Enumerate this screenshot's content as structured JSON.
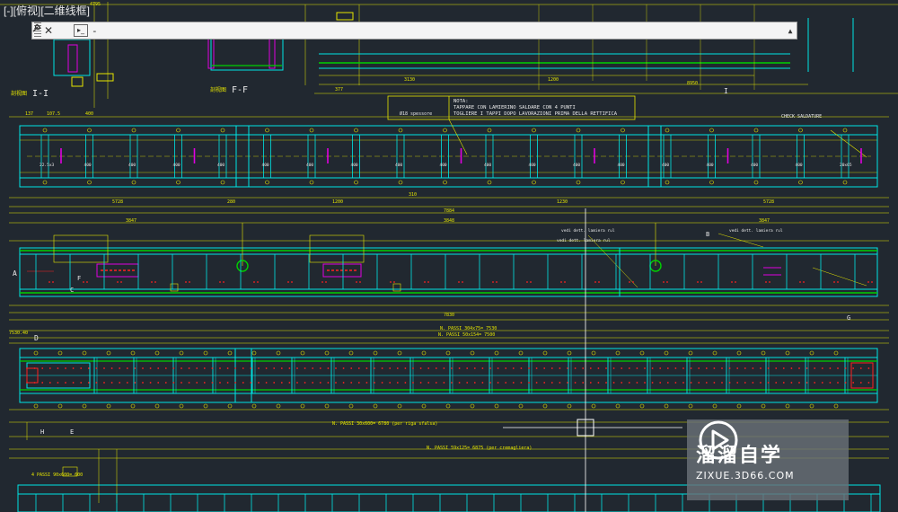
{
  "viewport": {
    "label": "[-][俯视][二维线框]",
    "colors": {
      "background": "#212830",
      "cyan": "#00e5e5",
      "yellow": "#e6e600",
      "green": "#00d000",
      "magenta": "#e000e0",
      "red": "#ff2020",
      "white": "#e8e8e8"
    }
  },
  "command_line": {
    "close_icon": "close-icon",
    "settings_icon": "wrench-icon",
    "prompt_icon": "command-prompt-icon",
    "prompt_glyph": "▸_",
    "input_value": "-",
    "dropdown_icon": "chevron-up-icon"
  },
  "drawing": {
    "section_labels": {
      "i_i": "I-I",
      "f_f": "F-F",
      "prefix": "剖视图"
    },
    "nota": {
      "title": "NOTA:",
      "line1": "TAPPARE CON LAMIERINO SALDARE CON 4 PUNTI",
      "line2": "TOGLIERE I TAPPI DOPO LAVORAZIONI PRIMA DELLA RETTIFICA",
      "side_label": "Ø18 spessore"
    },
    "check_label": "CHECK SALDATURE",
    "dims_top": {
      "d1": "137",
      "d2": "107.5",
      "d3": "400",
      "d4": "377",
      "d5": "3130",
      "d6": "1200",
      "d7": "8950",
      "d8": "4795"
    },
    "dims_band1": {
      "left": "5728",
      "mid1": "1200",
      "mid2": "1230",
      "right": "5728",
      "total": "7884",
      "h1": "280",
      "h2": "310"
    },
    "dims_band2": {
      "d1": "3847",
      "d2": "3848",
      "d3": "3847",
      "total": "7830"
    },
    "dims_band3": {
      "d1": "N. PASSI 304x75= 7530",
      "d2": "N. PASSI 50x154= 7500",
      "d3": "7530.40"
    },
    "bottom_notes": {
      "n1": "N. PASSI 30x600= 6780 (per riga sfalsa)",
      "n2": "N. PASSI 59x125= 6875 (per cremagliera)",
      "d1": "4 PASSI 90x600= 600"
    },
    "annotations": {
      "a1": "vedi dett. lamiera rul",
      "a2": "vedi dett. lamiera rul",
      "a3": "vedi dett. lamiera rul"
    },
    "markers": {
      "A": "A",
      "B": "B",
      "C": "C",
      "D": "D",
      "E": "E",
      "F": "F",
      "G": "G",
      "H": "H",
      "I": "I"
    },
    "hole_labels": [
      "22.5x3",
      "400",
      "400",
      "400",
      "400",
      "400",
      "400",
      "400",
      "400",
      "400",
      "400",
      "400",
      "400",
      "400",
      "400",
      "400",
      "400",
      "400",
      "20x65"
    ]
  },
  "watermark": {
    "title": "溜溜自学",
    "url": "ZIXUE.3D66.COM",
    "logo_icon": "play-logo-icon"
  }
}
